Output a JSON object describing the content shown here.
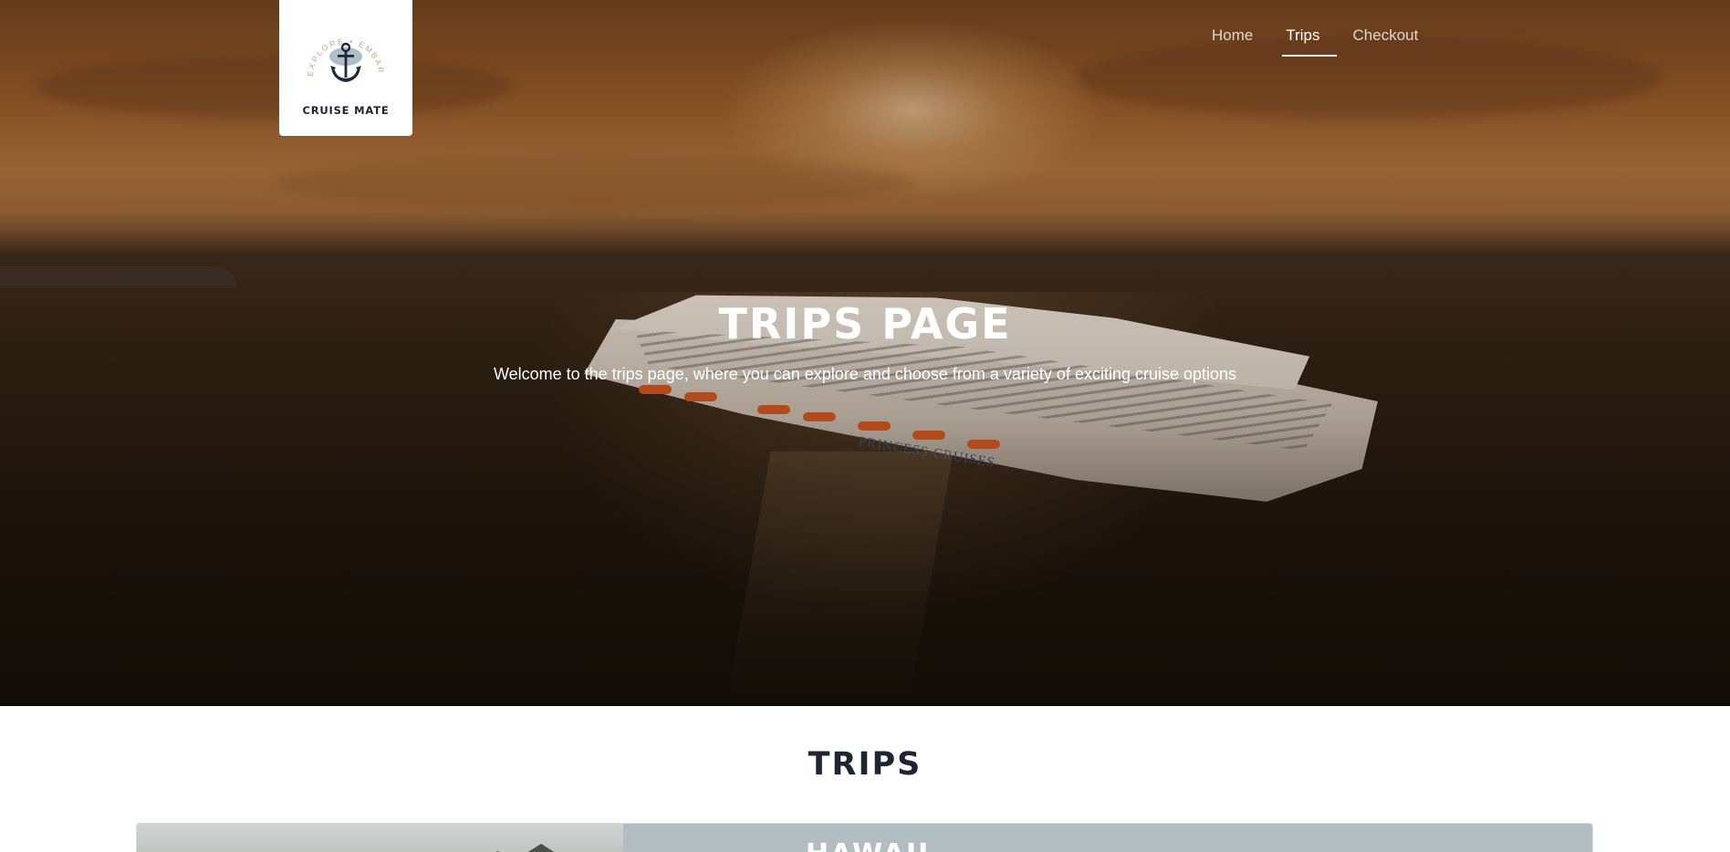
{
  "brand": {
    "name": "CRUISE MATE",
    "tagline": "EXPLORE • EMBARK • ENJOY!"
  },
  "nav": {
    "items": [
      {
        "label": "Home",
        "active": false
      },
      {
        "label": "Trips",
        "active": true
      },
      {
        "label": "Checkout",
        "active": false
      }
    ]
  },
  "hero": {
    "title": "TRIPS PAGE",
    "subtitle": "Welcome to the trips page, where you can explore and choose from a variety of exciting cruise options",
    "ship_name": "PRINCESS CRUISES"
  },
  "trips": {
    "title": "TRIPS",
    "items": [
      {
        "name": "HAWAII"
      }
    ]
  },
  "colors": {
    "text_dark": "#1e2530",
    "card_info_bg": "#b1bdc1",
    "nav_text": "#ffffff",
    "logo_anchor": "#1e2a3a",
    "logo_accent": "#c9a67a"
  }
}
